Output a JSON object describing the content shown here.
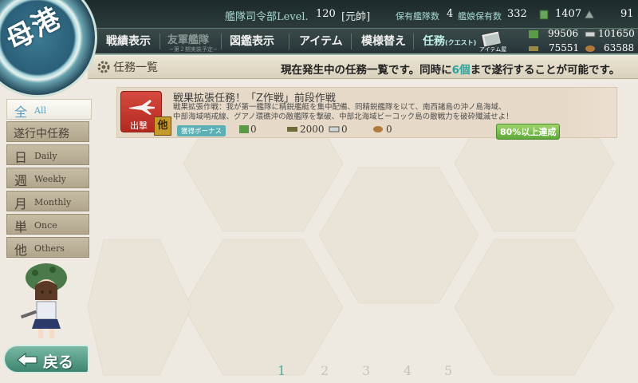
{
  "header": {
    "hq_label": "艦隊司令部Level.",
    "hq_level": "120",
    "rank": "[元帥]",
    "ship_count_label": "保有艦隊数",
    "ship_count": "4",
    "girl_count_label": "艦娘保有数",
    "girl_count": "332",
    "bucket_count": "1407",
    "devmat_count": "91",
    "emblem_text": "母港"
  },
  "nav": {
    "items": [
      {
        "label": "戦績表示"
      },
      {
        "label": "友軍艦隊",
        "sub": "~第２期実装予定~"
      },
      {
        "label": "図鑑表示"
      },
      {
        "label": "アイテム"
      },
      {
        "label": "模様替え"
      }
    ],
    "active_label": "任務",
    "active_sub": "(クエスト)",
    "item_shop_label": "アイテム屋"
  },
  "resources": {
    "fuel": "99506",
    "ammo": "75551",
    "steel": "101650",
    "bauxite": "63588"
  },
  "infobar": {
    "title": "任務一覧",
    "message_pre": "現在発生中の任務一覧です。同時に",
    "message_highlight": "6個",
    "message_post": "まで遂行することが可能です。"
  },
  "sidebar": {
    "tabs": [
      {
        "kanji": "全",
        "label": "All"
      },
      {
        "kanji": "遂行中任務",
        "label": ""
      },
      {
        "kanji": "日",
        "label": "Daily"
      },
      {
        "kanji": "週",
        "label": "Weekly"
      },
      {
        "kanji": "月",
        "label": "Monthly"
      },
      {
        "kanji": "単",
        "label": "Once"
      },
      {
        "kanji": "他",
        "label": "Others"
      }
    ]
  },
  "quest": {
    "category_label": "出撃",
    "type_tag": "他",
    "title": "戦果拡張任務！「Z作戦」前段作戦",
    "desc_line1": "戦果拡張作戦：我が第一艦隊に精鋭艦艇を集中配備、同精鋭艦隊を以て、南西諸島の沖ノ島海域、",
    "desc_line2": "中部海域哨戒線、グアノ環礁沖の敵艦隊を撃破、中部北海域ビーコック島の敵戦力を破砕殲滅せよ！",
    "bonus_label": "獲得ボーナス",
    "reward_fuel": "0",
    "reward_ammo": "2000",
    "reward_steel": "0",
    "reward_bauxite": "0",
    "progress": "80%以上達成"
  },
  "pager": [
    "1",
    "2",
    "3",
    "4",
    "5"
  ],
  "back_label": "戻る",
  "colors": {
    "accent": "#4ab0a6",
    "badge_red": "#c83a30",
    "progress_green": "#6fb845"
  }
}
